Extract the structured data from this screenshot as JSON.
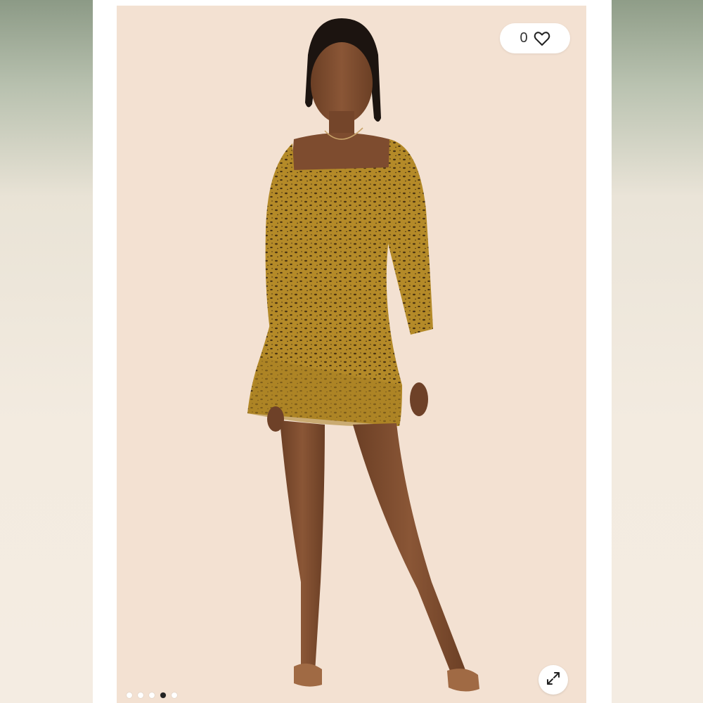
{
  "product_image": {
    "alt": "",
    "like_count": "0",
    "icons": {
      "like": "heart-icon",
      "expand": "expand-arrows-icon"
    },
    "carousel": {
      "total": 5,
      "active_index": 3
    }
  },
  "colors": {
    "photo_background": "#f3e1d2",
    "dress": "#b48a28",
    "dress_print": "#4a3412",
    "skin": "#7a4a2e",
    "card": "#ffffff",
    "dot_active": "#222222"
  }
}
